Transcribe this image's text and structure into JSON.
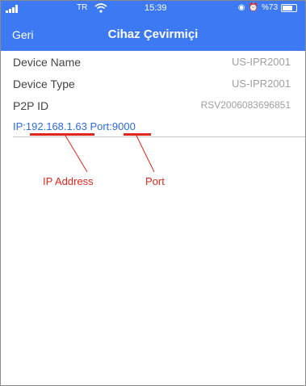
{
  "status_bar": {
    "carrier": "TR",
    "time": "15:39",
    "battery": "%73",
    "icons": [
      "signal-icon",
      "wifi-icon",
      "location-icon",
      "alarm-icon",
      "battery-icon"
    ]
  },
  "nav": {
    "back_label": "Geri",
    "title": "Cihaz Çevirmiçi"
  },
  "device": {
    "name_label": "Device Name",
    "name_value": "US-IPR2001",
    "type_label": "Device Type",
    "type_value": "US-IPR2001",
    "p2p_label": "P2P ID",
    "p2p_value": "RSV2006083696851"
  },
  "network": {
    "ip_label": "IP:",
    "ip_value": "192.168.1.63",
    "port_label": "Port:",
    "port_value": "9000"
  },
  "annotations": {
    "ip_address": "IP Address",
    "port": "Port"
  },
  "colors": {
    "nav_bg": "#3d79f2",
    "link_blue": "#2c6be0",
    "annotation_red": "#e0261c",
    "value_gray": "#a0a0a0"
  }
}
